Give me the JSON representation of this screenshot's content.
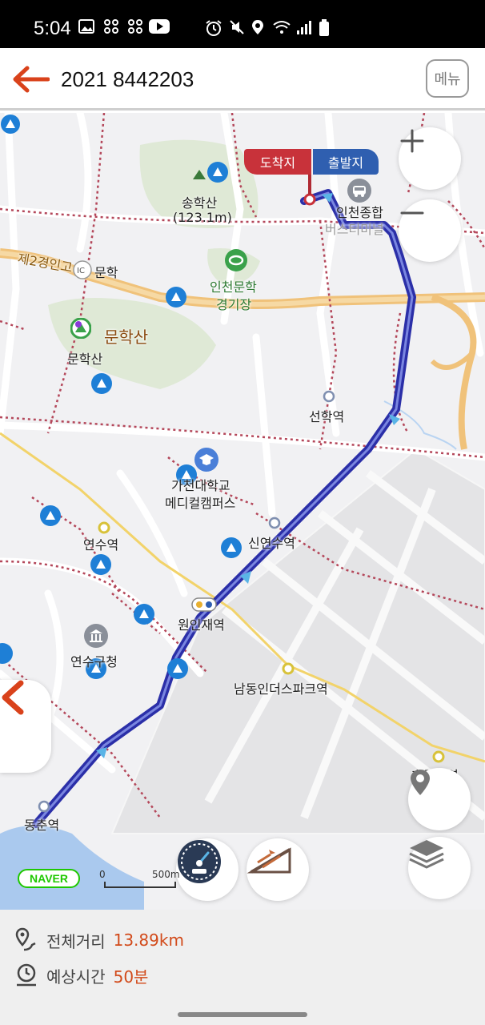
{
  "status_bar": {
    "time": "5:04",
    "left_icons": [
      "image-icon",
      "grid-icon",
      "grid-icon",
      "youtube-icon"
    ],
    "right_icons": [
      "alarm-icon",
      "mute-icon",
      "location-icon",
      "wifi-icon",
      "signal-icon",
      "battery-icon"
    ]
  },
  "header": {
    "title": "2021 8442203",
    "menu_label": "메뉴",
    "accent_color": "#d9421b"
  },
  "map": {
    "flag": {
      "destination": "도착지",
      "origin": "출발지"
    },
    "labels": {
      "songhaksan": "송학산",
      "songhaksan_height": "(123.1m)",
      "incheon_terminal": "인천종합",
      "incheon_terminal_2": "버스터미널",
      "jesecond": "제2경인고",
      "ic": "IC",
      "munhak": "문학",
      "stadium_1": "인천문학",
      "stadium_2": "경기장",
      "munhaksan_big": "문학산",
      "munhaksan_small": "문학산",
      "seonhak": "선학역",
      "gachon_1": "가천대학교",
      "gachon_2": "메디컬캠퍼스",
      "yeonsu_station": "연수역",
      "sinyeonsu": "신연수역",
      "woninjae": "원인재역",
      "yeonsu_office": "연수구청",
      "namdong_industrial": "남동인더스파크역",
      "hogupo": "호구포역",
      "dongchun": "동춘역"
    },
    "scale": {
      "zero": "0",
      "distance": "500m"
    },
    "naver_logo": "NAVER"
  },
  "info": {
    "distance_label": "전체거리",
    "distance_value": "13.89km",
    "time_label": "예상시간",
    "time_value": "50분"
  },
  "colors": {
    "route": "#2b2fa8",
    "route_inner": "#7a86e0",
    "rail_dotted": "#b4475a",
    "major_road": "#f0c27a",
    "park": "#dfe9d6",
    "accent": "#d9421b"
  }
}
